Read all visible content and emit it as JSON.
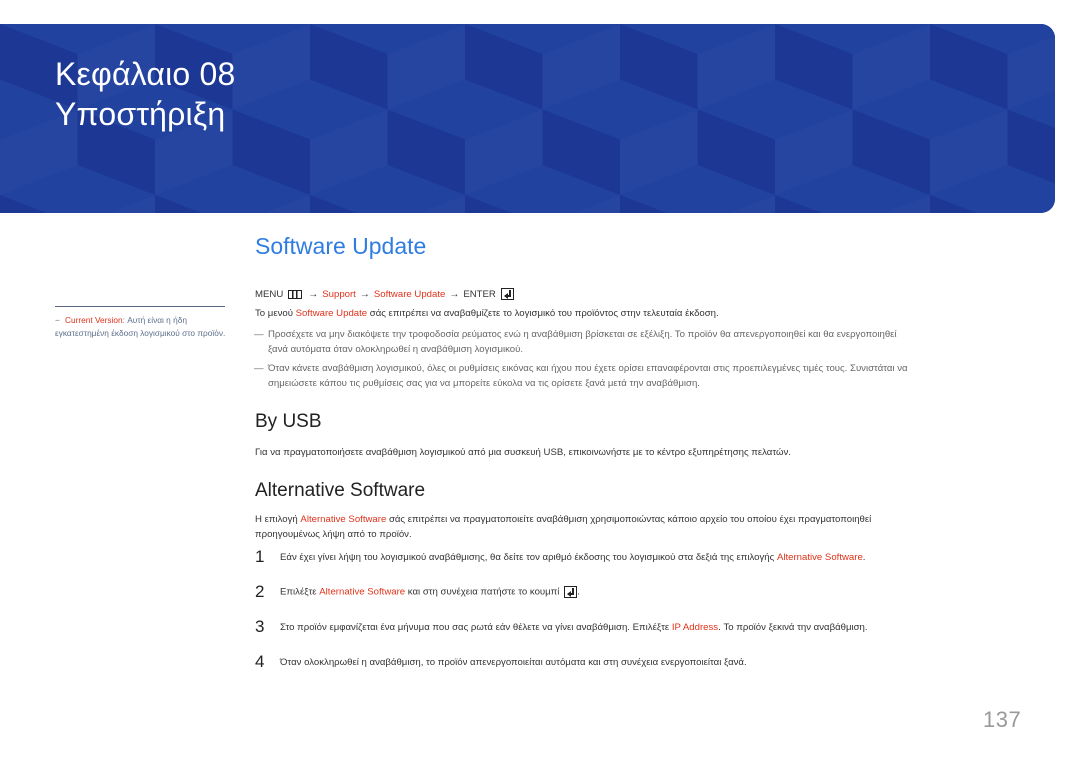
{
  "banner": {
    "chapter_label": "Κεφάλαιο 08",
    "chapter_title": "Υποστήριξη",
    "background_color": "#1f3b9a"
  },
  "sidebar_note": {
    "dash": "−",
    "term": "Current Version",
    "text": ": Αυτή είναι η ήδη εγκατεστημένη έκδοση λογισμικού στο προϊόν."
  },
  "section": {
    "title": "Software Update",
    "menu_path": {
      "menu": "MENU",
      "menu_icon": "menu-grid-icon",
      "arrow": "→",
      "item1": "Support",
      "item2": "Software Update",
      "enter": "ENTER",
      "enter_icon": "enter-return-icon"
    },
    "intro": {
      "before": "Το μενού ",
      "term": "Software Update",
      "after": " σάς επιτρέπει να αναβαθμίζετε το λογισμικό του προϊόντος στην τελευταία έκδοση."
    },
    "notes": [
      {
        "dash": "―",
        "line1": "Προσέχετε να μην διακόψετε την τροφοδοσία ρεύματος ενώ η αναβάθμιση βρίσκεται σε εξέλιξη. Το προϊόν θα απενεργοποιηθεί και θα ενεργοποιηθεί",
        "line2": "ξανά αυτόματα όταν ολοκληρωθεί η αναβάθμιση λογισμικού."
      },
      {
        "dash": "―",
        "line1": "Όταν κάνετε αναβάθμιση λογισμικού, όλες οι ρυθμίσεις εικόνας και ήχου που έχετε ορίσει επαναφέρονται στις προεπιλεγμένες τιμές τους. Συνιστάται να",
        "line2": "σημειώσετε κάπου τις ρυθμίσεις σας για να μπορείτε εύκολα να τις ορίσετε ξανά μετά την αναβάθμιση."
      }
    ]
  },
  "by_usb": {
    "title": "By USB",
    "text": "Για να πραγματοποιήσετε αναβάθμιση λογισμικού από μια συσκευή USB, επικοινωνήστε με το κέντρο εξυπηρέτησης πελατών."
  },
  "alternative_software": {
    "title": "Alternative Software",
    "intro": {
      "before": "Η επιλογή ",
      "term": "Alternative Software",
      "after_line1": " σάς επιτρέπει να πραγματοποιείτε αναβάθμιση χρησιμοποιώντας κάποιο αρχείο του οποίου έχει πραγματοποιηθεί",
      "line2": "προηγουμένως λήψη από το προϊόν."
    },
    "steps": [
      {
        "num": "1",
        "before": "Εάν έχει γίνει λήψη του λογισμικού αναβάθμισης, θα δείτε τον αριθμό έκδοσης του λογισμικού στα δεξιά της επιλογής ",
        "term": "Alternative Software",
        "after": "."
      },
      {
        "num": "2",
        "before": "Επιλέξτε ",
        "term": "Alternative Software",
        "after": " και στη συνέχεια πατήστε το κουμπί ",
        "end": "."
      },
      {
        "num": "3",
        "before": "Στο προϊόν εμφανίζεται ένα μήνυμα που σας ρωτά εάν θέλετε να γίνει αναβάθμιση. Επιλέξτε ",
        "term": "IP Address",
        "after": ". Το προϊόν ξεκινά την αναβάθμιση."
      },
      {
        "num": "4",
        "text": "Όταν ολοκληρωθεί η αναβάθμιση, το προϊόν απενεργοποιείται αυτόματα και στη συνέχεια ενεργοποιείται ξανά."
      }
    ]
  },
  "colors": {
    "heading_blue": "#2f7de1",
    "highlight_red": "#e0321a"
  },
  "page_number": "137"
}
